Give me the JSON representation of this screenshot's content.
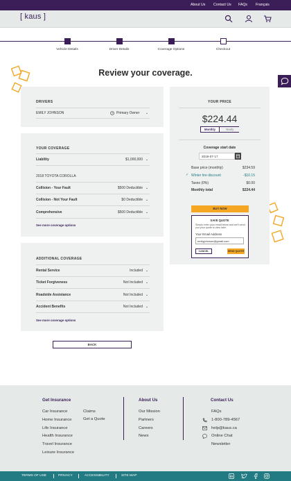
{
  "topbar": {
    "about": "About Us",
    "contact": "Contact Us",
    "faqs": "FAQs",
    "lang": "Français"
  },
  "header": {
    "logo": "kaus"
  },
  "progress": {
    "steps": [
      "Vehicle Details",
      "Driver Details",
      "Coverage Options",
      "Checkout"
    ],
    "completed": 3
  },
  "page": {
    "title": "Review your coverage."
  },
  "drivers": {
    "title": "DRIVERS",
    "name": "EMILY JOHNSON",
    "role": "Primary Owner"
  },
  "coverage": {
    "title": "YOUR COVERAGE",
    "liability_label": "Liability",
    "liability_value": "$1,000,000",
    "vehicle": "2018 TOYOTA COROLLA",
    "rows": [
      {
        "label": "Collision - Your Fault",
        "value": "$500 Deductible"
      },
      {
        "label": "Collision - Not Your Fault",
        "value": "$0 Deductible"
      },
      {
        "label": "Comprehensive",
        "value": "$500 Deductible"
      }
    ],
    "more": "See more coverage options"
  },
  "additional": {
    "title": "ADDITIONAL COVERAGE",
    "rows": [
      {
        "label": "Rental Service",
        "value": "Included"
      },
      {
        "label": "Ticket Forgiveness",
        "value": "Not Included"
      },
      {
        "label": "Roadside Assistance",
        "value": "Not Included"
      },
      {
        "label": "Accident Benefits",
        "value": "Not Included"
      }
    ],
    "more": "See more coverage options"
  },
  "price": {
    "title": "YOUR PRICE",
    "amount": "$224.44",
    "monthly": "Monthly",
    "yearly": "Yearly",
    "start_label": "Coverage start date",
    "start_date": "2019-07-17",
    "lines": [
      {
        "label": "Base price (monthly)",
        "value": "$234.59"
      },
      {
        "label": "Winter tire discount",
        "value": "-$10.15"
      },
      {
        "label": "Taxes (0%)",
        "value": "$0.00"
      },
      {
        "label": "Monthly total",
        "value": "$224.44"
      }
    ],
    "buy": "BUY NOW"
  },
  "save": {
    "title": "SAVE QUOTE",
    "desc": "Simply enter your email below and we'll send you your quote to view later.",
    "email_label": "Your Email Address",
    "email_value": "emilyjohnson@gmail.com",
    "cancel": "CANCEL",
    "send": "SEND QUOTE"
  },
  "back": "BACK",
  "footer": {
    "insurance_title": "Get Insurance",
    "insurance_col1": [
      "Car Insurance",
      "Home Insurance",
      "Life Insurance",
      "Health Insurance",
      "Travel Insurance",
      "Leisure Insurance"
    ],
    "insurance_col2": [
      "Claims",
      "Get a Quote"
    ],
    "about_title": "About Us",
    "about_links": [
      "Our Mission",
      "Partners",
      "Careers",
      "News"
    ],
    "contact_title": "Contact Us",
    "contact_faqs": "FAQs",
    "phone": "1-800-789-4567",
    "email": "help@kaus.ca",
    "chat": "Online Chat",
    "newsletter": "Newsletter"
  },
  "bottom": {
    "terms": "TERMS OF USE",
    "privacy": "PRIVACY",
    "accessibility": "ACCESSIBILITY",
    "sitemap": "SITE MAP"
  },
  "colors": {
    "brand": "#3b1d57",
    "accent": "#f5a623",
    "teal": "#227b83"
  }
}
